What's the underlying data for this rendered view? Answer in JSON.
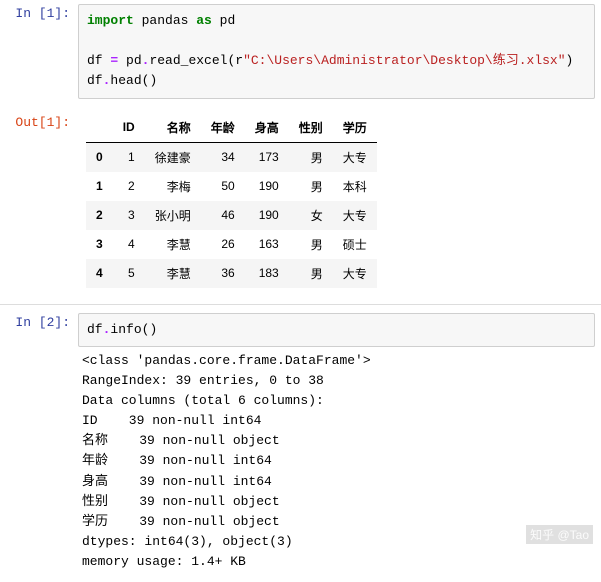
{
  "cell1": {
    "in_label": "In [1]:",
    "code": {
      "l1_kw1": "import",
      "l1_name1": " pandas ",
      "l1_kw2": "as",
      "l1_name2": " pd",
      "l3_a": "df ",
      "l3_op": "=",
      "l3_b": " pd",
      "l3_dot1": ".",
      "l3_fn": "read_excel",
      "l3_p1": "(",
      "l3_r": "r",
      "l3_str": "\"C:\\Users\\Administrator\\Desktop\\练习.xlsx\"",
      "l3_p2": ")",
      "l4_a": "df",
      "l4_dot": ".",
      "l4_fn": "head",
      "l4_p": "()"
    }
  },
  "out1": {
    "out_label": "Out[1]:",
    "columns": [
      "",
      "ID",
      "名称",
      "年龄",
      "身高",
      "性别",
      "学历"
    ],
    "rows": [
      {
        "idx": "0",
        "ID": "1",
        "name": "徐建豪",
        "age": "34",
        "height": "173",
        "sex": "男",
        "edu": "大专"
      },
      {
        "idx": "1",
        "ID": "2",
        "name": "李梅",
        "age": "50",
        "height": "190",
        "sex": "男",
        "edu": "本科"
      },
      {
        "idx": "2",
        "ID": "3",
        "name": "张小明",
        "age": "46",
        "height": "190",
        "sex": "女",
        "edu": "大专"
      },
      {
        "idx": "3",
        "ID": "4",
        "name": "李慧",
        "age": "26",
        "height": "163",
        "sex": "男",
        "edu": "硕士"
      },
      {
        "idx": "4",
        "ID": "5",
        "name": "李慧",
        "age": "36",
        "height": "183",
        "sex": "男",
        "edu": "大专"
      }
    ]
  },
  "cell2": {
    "in_label": "In [2]:",
    "code": {
      "a": "df",
      "dot": ".",
      "fn": "info",
      "p": "()"
    }
  },
  "out2": {
    "text": "<class 'pandas.core.frame.DataFrame'>\nRangeIndex: 39 entries, 0 to 38\nData columns (total 6 columns):\nID    39 non-null int64\n名称    39 non-null object\n年龄    39 non-null int64\n身高    39 non-null int64\n性别    39 non-null object\n学历    39 non-null object\ndtypes: int64(3), object(3)\nmemory usage: 1.4+ KB"
  },
  "watermark": "知乎 @Tao"
}
